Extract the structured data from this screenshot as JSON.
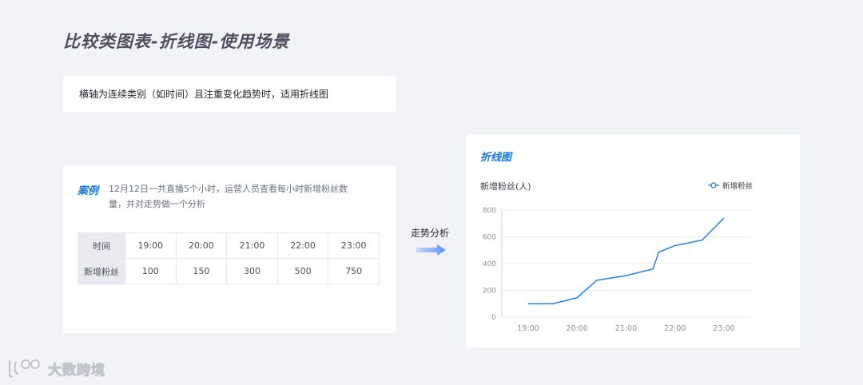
{
  "page": {
    "title": "比较类图表-折线图-使用场景"
  },
  "note": {
    "text": "横轴为连续类别（如时间）且注重变化趋势时，适用折线图"
  },
  "case": {
    "label": "案例",
    "description": "12月12日一共直播5个小时，运营人员查看每小时新增粉丝数量，并对走势做一个分析",
    "table": {
      "header_label": "时间",
      "row_label": "新增粉丝",
      "times": [
        "19:00",
        "20:00",
        "21:00",
        "22:00",
        "23:00"
      ],
      "values": [
        "100",
        "150",
        "300",
        "500",
        "750"
      ]
    }
  },
  "arrow": {
    "label": "走势分析"
  },
  "chart_card": {
    "title": "折线图"
  },
  "chart_data": {
    "type": "line",
    "title": "",
    "ylabel": "新增粉丝(人)",
    "xlabel": "",
    "ylim": [
      0,
      800
    ],
    "yticks": [
      0,
      200,
      400,
      600,
      800
    ],
    "xticks": [
      "19:00",
      "20:00",
      "21:00",
      "22:00",
      "23:00"
    ],
    "grid": true,
    "legend": "top-right",
    "series": [
      {
        "name": "新增粉丝",
        "color": "#1677e5",
        "points": [
          [
            "19:00",
            100
          ],
          [
            "19:30",
            100
          ],
          [
            "20:00",
            145
          ],
          [
            "20:24",
            275
          ],
          [
            "21:00",
            310
          ],
          [
            "21:33",
            360
          ],
          [
            "21:40",
            485
          ],
          [
            "22:00",
            535
          ],
          [
            "22:33",
            575
          ],
          [
            "23:00",
            740
          ]
        ]
      }
    ]
  },
  "watermark": {
    "text": "大数跨境"
  }
}
